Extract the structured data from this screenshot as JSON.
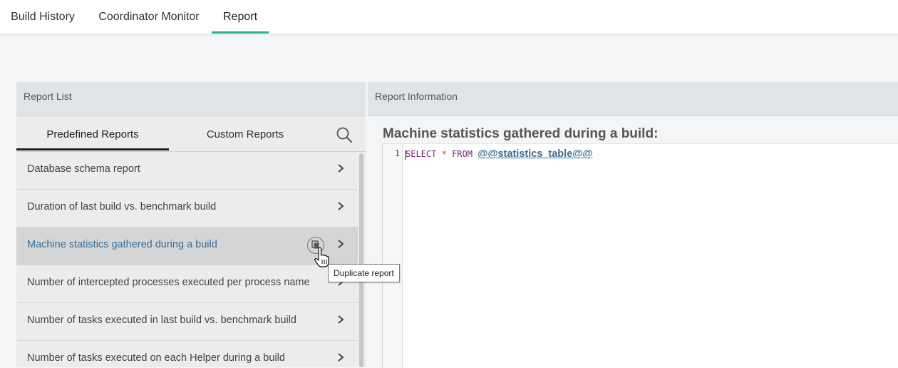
{
  "nav": {
    "tabs": [
      {
        "label": "Build History"
      },
      {
        "label": "Coordinator Monitor"
      },
      {
        "label": "Report",
        "active": true
      }
    ]
  },
  "report_list": {
    "header": "Report List",
    "subtabs": [
      {
        "label": "Predefined Reports",
        "active": true
      },
      {
        "label": "Custom Reports"
      }
    ],
    "search_icon": "search-icon",
    "items": [
      {
        "label": "Database schema report"
      },
      {
        "label": "Duration of last build vs. benchmark build"
      },
      {
        "label": "Machine statistics gathered during a build",
        "selected": true
      },
      {
        "label": "Number of intercepted processes executed per process name"
      },
      {
        "label": "Number of tasks executed in last build vs. benchmark build"
      },
      {
        "label": "Number of tasks executed on each Helper during a build"
      }
    ],
    "duplicate_tooltip": "Duplicate report"
  },
  "report_info": {
    "header": "Report Information",
    "title": "Machine statistics gathered during a build:",
    "editor": {
      "line_number": "1",
      "keyword_select": "SELECT",
      "operator_star": "*",
      "keyword_from": "FROM",
      "variable": "@@statistics_table@@"
    }
  },
  "colors": {
    "accent_underline": "#2bb58f",
    "selected_text": "#3d6e95",
    "sql_keyword": "#7a1f7a"
  }
}
